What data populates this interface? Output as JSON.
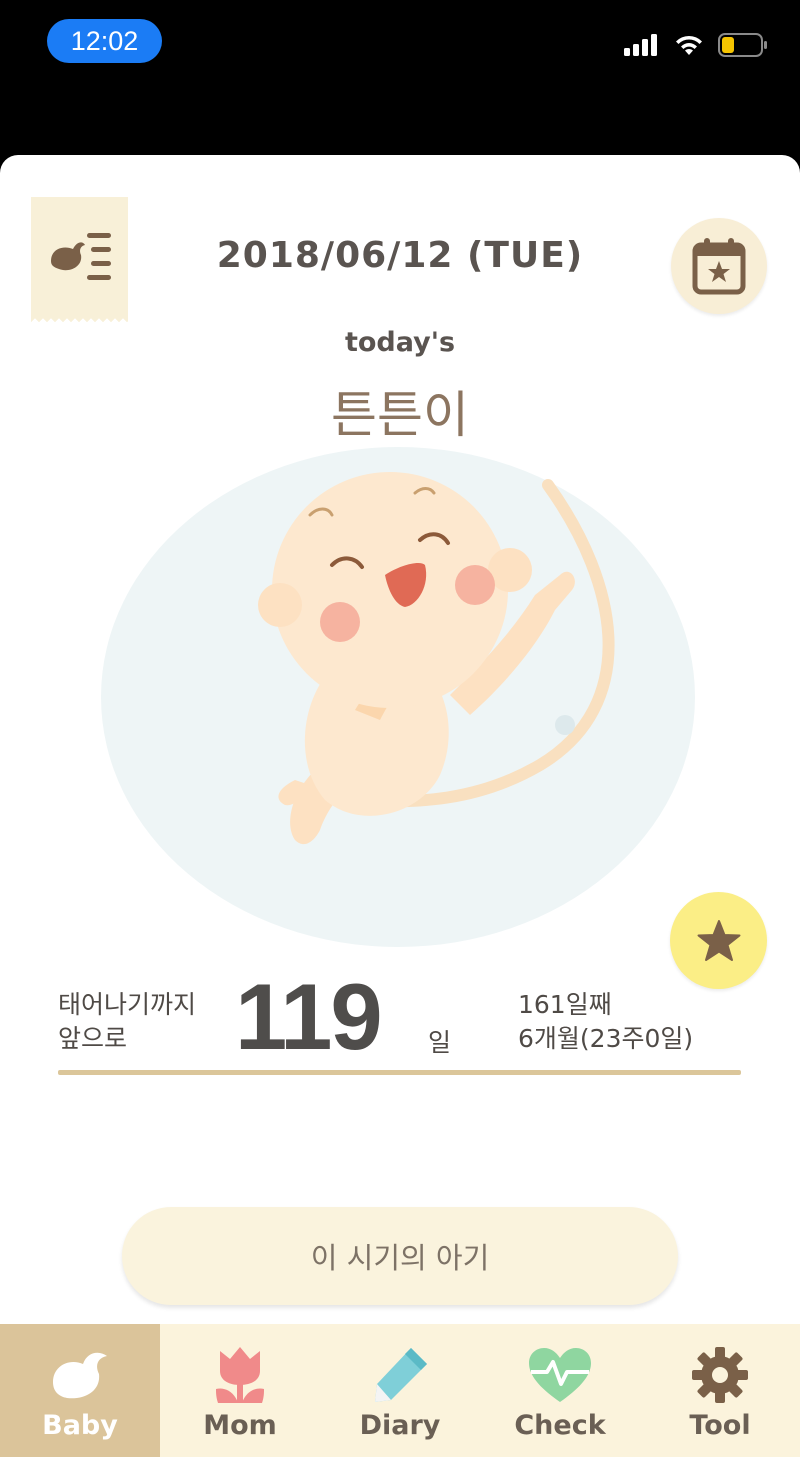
{
  "status_bar": {
    "time": "12:02"
  },
  "header": {
    "date": "2018/06/12 (TUE)",
    "menu_icon": "bird-list-icon",
    "calendar_icon": "calendar-star-icon"
  },
  "baby": {
    "todays_label": "today's",
    "name": "튼튼이"
  },
  "countdown": {
    "label_line1": "태어나기까지",
    "label_line2": "앞으로",
    "days": "119",
    "unit": "일",
    "day_count": "161일째",
    "age": "6개월(23주0일)"
  },
  "period_button": {
    "label": "이 시기의 아기"
  },
  "tabs": [
    {
      "label": "Baby",
      "icon": "bird-icon",
      "active": true
    },
    {
      "label": "Mom",
      "icon": "tulip-icon",
      "active": false
    },
    {
      "label": "Diary",
      "icon": "pencil-icon",
      "active": false
    },
    {
      "label": "Check",
      "icon": "heart-pulse-icon",
      "active": false
    },
    {
      "label": "Tool",
      "icon": "gear-icon",
      "active": false
    }
  ],
  "colors": {
    "accent": "#dbc49a",
    "tab_bar": "#fbf3dc",
    "star_button": "#fbee86",
    "time_pill": "#1b7cf5"
  }
}
